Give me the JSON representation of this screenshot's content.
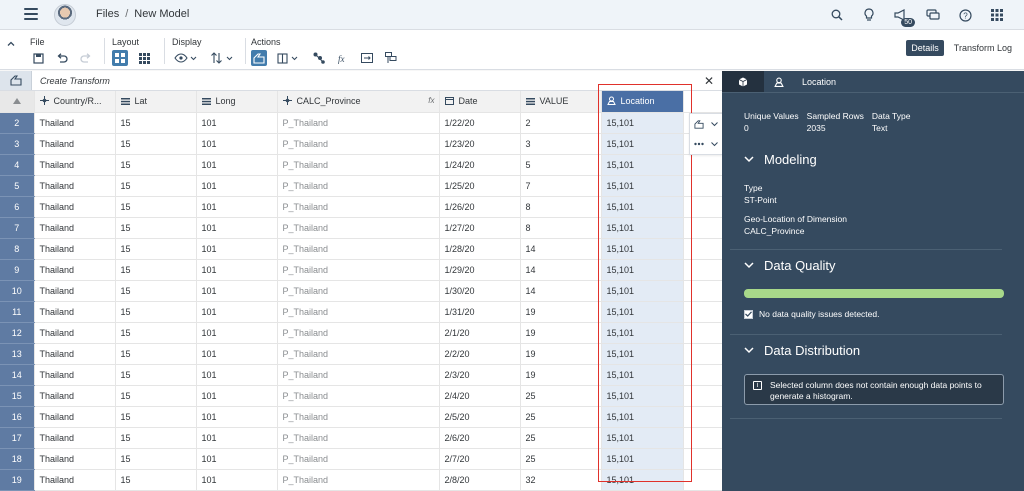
{
  "shell": {
    "breadcrumb": [
      "Files",
      "/",
      "New Model"
    ],
    "notification_count": "50"
  },
  "toolbar": {
    "groups": {
      "file": "File",
      "layout": "Layout",
      "display": "Display",
      "actions": "Actions"
    },
    "details_label": "Details",
    "transform_log_label": "Transform Log"
  },
  "transform": {
    "placeholder": "Create Transform"
  },
  "grid": {
    "columns": [
      "Country/R...",
      "Lat",
      "Long",
      "CALC_Province",
      "Date",
      "VALUE",
      "Location"
    ],
    "rows": [
      {
        "n": "2",
        "country": "Thailand",
        "lat": "15",
        "long": "101",
        "prov": "P_Thailand",
        "date": "1/22/20",
        "value": "2",
        "loc": "15,101"
      },
      {
        "n": "3",
        "country": "Thailand",
        "lat": "15",
        "long": "101",
        "prov": "P_Thailand",
        "date": "1/23/20",
        "value": "3",
        "loc": "15,101"
      },
      {
        "n": "4",
        "country": "Thailand",
        "lat": "15",
        "long": "101",
        "prov": "P_Thailand",
        "date": "1/24/20",
        "value": "5",
        "loc": "15,101"
      },
      {
        "n": "5",
        "country": "Thailand",
        "lat": "15",
        "long": "101",
        "prov": "P_Thailand",
        "date": "1/25/20",
        "value": "7",
        "loc": "15,101"
      },
      {
        "n": "6",
        "country": "Thailand",
        "lat": "15",
        "long": "101",
        "prov": "P_Thailand",
        "date": "1/26/20",
        "value": "8",
        "loc": "15,101"
      },
      {
        "n": "7",
        "country": "Thailand",
        "lat": "15",
        "long": "101",
        "prov": "P_Thailand",
        "date": "1/27/20",
        "value": "8",
        "loc": "15,101"
      },
      {
        "n": "8",
        "country": "Thailand",
        "lat": "15",
        "long": "101",
        "prov": "P_Thailand",
        "date": "1/28/20",
        "value": "14",
        "loc": "15,101"
      },
      {
        "n": "9",
        "country": "Thailand",
        "lat": "15",
        "long": "101",
        "prov": "P_Thailand",
        "date": "1/29/20",
        "value": "14",
        "loc": "15,101"
      },
      {
        "n": "10",
        "country": "Thailand",
        "lat": "15",
        "long": "101",
        "prov": "P_Thailand",
        "date": "1/30/20",
        "value": "14",
        "loc": "15,101"
      },
      {
        "n": "11",
        "country": "Thailand",
        "lat": "15",
        "long": "101",
        "prov": "P_Thailand",
        "date": "1/31/20",
        "value": "19",
        "loc": "15,101"
      },
      {
        "n": "12",
        "country": "Thailand",
        "lat": "15",
        "long": "101",
        "prov": "P_Thailand",
        "date": "2/1/20",
        "value": "19",
        "loc": "15,101"
      },
      {
        "n": "13",
        "country": "Thailand",
        "lat": "15",
        "long": "101",
        "prov": "P_Thailand",
        "date": "2/2/20",
        "value": "19",
        "loc": "15,101"
      },
      {
        "n": "14",
        "country": "Thailand",
        "lat": "15",
        "long": "101",
        "prov": "P_Thailand",
        "date": "2/3/20",
        "value": "19",
        "loc": "15,101"
      },
      {
        "n": "15",
        "country": "Thailand",
        "lat": "15",
        "long": "101",
        "prov": "P_Thailand",
        "date": "2/4/20",
        "value": "25",
        "loc": "15,101"
      },
      {
        "n": "16",
        "country": "Thailand",
        "lat": "15",
        "long": "101",
        "prov": "P_Thailand",
        "date": "2/5/20",
        "value": "25",
        "loc": "15,101"
      },
      {
        "n": "17",
        "country": "Thailand",
        "lat": "15",
        "long": "101",
        "prov": "P_Thailand",
        "date": "2/6/20",
        "value": "25",
        "loc": "15,101"
      },
      {
        "n": "18",
        "country": "Thailand",
        "lat": "15",
        "long": "101",
        "prov": "P_Thailand",
        "date": "2/7/20",
        "value": "25",
        "loc": "15,101"
      },
      {
        "n": "19",
        "country": "Thailand",
        "lat": "15",
        "long": "101",
        "prov": "P_Thailand",
        "date": "2/8/20",
        "value": "32",
        "loc": "15,101"
      }
    ]
  },
  "panel": {
    "tab_label": "Location",
    "stats": {
      "unique_label": "Unique Values",
      "unique_value": "0",
      "sampled_label": "Sampled Rows",
      "sampled_value": "2035",
      "type_label": "Data Type",
      "type_value": "Text"
    },
    "modeling": {
      "title": "Modeling",
      "type_label": "Type",
      "type_value": "ST-Point",
      "geo_label": "Geo-Location of Dimension",
      "geo_value": "CALC_Province"
    },
    "quality": {
      "title": "Data Quality",
      "check_label": "No data quality issues detected.",
      "bar_color": "#a8d98a"
    },
    "distribution": {
      "title": "Data Distribution",
      "info": "Selected column does not contain enough data points to generate a histogram."
    }
  },
  "colors": {
    "shell_bg": "#eff4f9",
    "panel_bg": "#354a5f",
    "selected_column": "#4a6fa5",
    "highlight": "#e0312b"
  }
}
